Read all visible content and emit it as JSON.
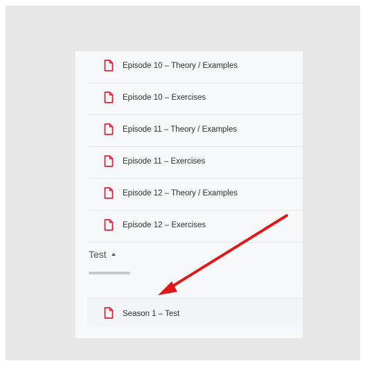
{
  "colors": {
    "document_icon": "#d8253a",
    "arrow": "#e21818",
    "panel_background": "#f7f8fa",
    "outer_background": "#e8e8e8"
  },
  "files": [
    {
      "label": "Episode 10 – Theory / Examples",
      "icon": "document-icon"
    },
    {
      "label": "Episode 10 – Exercises",
      "icon": "document-icon"
    },
    {
      "label": "Episode 11 – Theory / Examples",
      "icon": "document-icon"
    },
    {
      "label": "Episode 11 – Exercises",
      "icon": "document-icon"
    },
    {
      "label": "Episode 12 – Theory / Examples",
      "icon": "document-icon"
    },
    {
      "label": "Episode 12 – Exercises",
      "icon": "document-icon"
    }
  ],
  "test_section": {
    "title": "Test",
    "expanded": true,
    "progress_fraction": 1.0,
    "items": [
      {
        "label": "Season 1 – Test",
        "icon": "document-icon"
      }
    ]
  },
  "annotation": {
    "icon": "red-arrow",
    "points_to": "Season 1 – Test"
  }
}
